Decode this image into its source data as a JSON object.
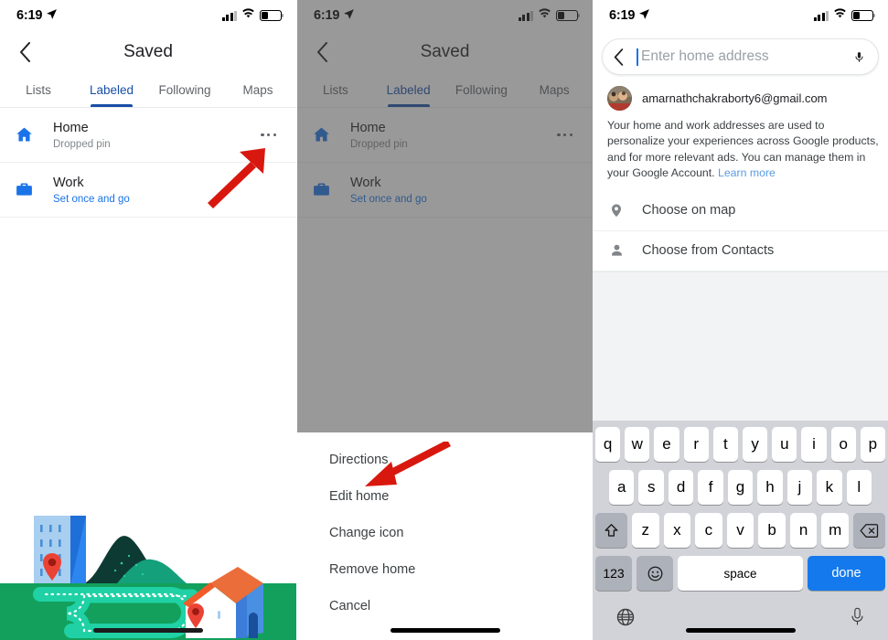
{
  "status_bar": {
    "time": "6:19",
    "location_icon": "location-arrow-icon",
    "signal_icon": "cellular-signal-icon",
    "wifi_icon": "wifi-icon",
    "battery_icon": "battery-low-icon"
  },
  "panel1": {
    "nav": {
      "back_icon": "back-chevron-icon",
      "title": "Saved"
    },
    "tabs": [
      {
        "label": "Lists",
        "active": false
      },
      {
        "label": "Labeled",
        "active": true
      },
      {
        "label": "Following",
        "active": false
      },
      {
        "label": "Maps",
        "active": false
      }
    ],
    "rows": [
      {
        "icon": "home-icon",
        "title": "Home",
        "subtitle": "Dropped pin",
        "subtitle_is_link": false,
        "overflow_icon": "more-options-icon"
      },
      {
        "icon": "work-briefcase-icon",
        "title": "Work",
        "subtitle": "Set once and go",
        "subtitle_is_link": true
      }
    ],
    "annotation": "red-arrow-pointing-to-more-options",
    "illustration": "map-route-city-to-house-illustration"
  },
  "panel2": {
    "nav": {
      "back_icon": "back-chevron-icon",
      "title": "Saved"
    },
    "tabs": [
      {
        "label": "Lists",
        "active": false
      },
      {
        "label": "Labeled",
        "active": true
      },
      {
        "label": "Following",
        "active": false
      },
      {
        "label": "Maps",
        "active": false
      }
    ],
    "rows": [
      {
        "icon": "home-icon",
        "title": "Home",
        "subtitle": "Dropped pin",
        "subtitle_is_link": false,
        "overflow_icon": "more-options-icon"
      },
      {
        "icon": "work-briefcase-icon",
        "title": "Work",
        "subtitle": "Set once and go",
        "subtitle_is_link": true
      }
    ],
    "action_sheet": {
      "items": [
        "Directions",
        "Edit home",
        "Change icon",
        "Remove home",
        "Cancel"
      ]
    },
    "annotation": "red-arrow-pointing-to-edit-home"
  },
  "panel3": {
    "search": {
      "back_icon": "back-chevron-icon",
      "placeholder": "Enter home address",
      "value": "",
      "mic_icon": "microphone-icon"
    },
    "account": {
      "avatar": "user-avatar-photo",
      "email": "amarnathchakraborty6@gmail.com"
    },
    "privacy": {
      "text": "Your home and work addresses are used to personalize your experiences across Google products, and for more relevant ads. You can manage them in your Google Account. ",
      "link_label": "Learn more"
    },
    "choices": [
      {
        "icon": "map-pin-icon",
        "label": "Choose on map"
      },
      {
        "icon": "person-icon",
        "label": "Choose from Contacts"
      }
    ],
    "keyboard": {
      "row1": [
        "q",
        "w",
        "e",
        "r",
        "t",
        "y",
        "u",
        "i",
        "o",
        "p"
      ],
      "row2": [
        "a",
        "s",
        "d",
        "f",
        "g",
        "h",
        "j",
        "k",
        "l"
      ],
      "row3_letters": [
        "z",
        "x",
        "c",
        "v",
        "b",
        "n",
        "m"
      ],
      "shift_icon": "shift-arrow-icon",
      "backspace_icon": "backspace-icon",
      "numbers_label": "123",
      "emoji_icon": "emoji-smiley-icon",
      "space_label": "space",
      "done_label": "done",
      "globe_icon": "globe-language-icon",
      "dictation_icon": "microphone-dictation-icon"
    }
  },
  "colors": {
    "accent_blue": "#1a73e8",
    "tab_active": "#174ea6",
    "annotation_red": "#d8180f",
    "keyboard_bg": "#d1d3d9",
    "done_blue": "#1479ec",
    "illustration_green": "#0f9d58"
  }
}
